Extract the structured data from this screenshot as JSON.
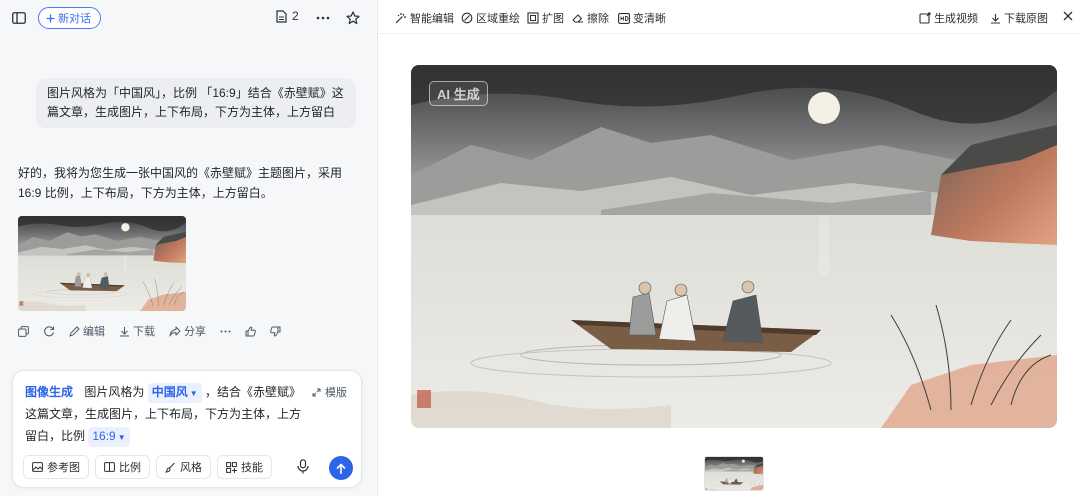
{
  "header_left": {
    "new_chat_label": "新对话",
    "doc_count": "2"
  },
  "conversation": {
    "user_message": "图片风格为「中国风」，比例 「16:9」结合《赤壁赋》这篇文章，生成图片，上下布局，下方为主体，上方留白",
    "assistant_message": "好的，我将为您生成一张中国风的《赤壁赋》主题图片，采用 16:9 比例，上下布局，下方为主体，上方留白。",
    "actions": {
      "edit": "编辑",
      "download": "下载",
      "share": "分享"
    }
  },
  "composer": {
    "mode": "图像生成",
    "text_before": "图片风格为",
    "style_chip": "中国风",
    "text_middle": "，结合《赤壁赋》这篇文章，生成图片，上下布局，下方为主体，上方留白，比例",
    "ratio_chip": "16:9",
    "template_label": "模版",
    "tools": [
      "参考图",
      "比例",
      "风格",
      "技能"
    ]
  },
  "editor_toolbar": {
    "smart_edit": "智能编辑",
    "region_redraw": "区域重绘",
    "expand": "扩图",
    "erase": "擦除",
    "sharpen": "变清晰",
    "generate_video": "生成视频",
    "download_original": "下载原图"
  },
  "image": {
    "watermark": "AI 生成"
  },
  "colors": {
    "accent": "#2d64e8",
    "panel_bg": "#f6f7f9"
  },
  "icons": [
    "sidebar-icon",
    "plus-icon",
    "document-icon",
    "more-icon",
    "star-icon",
    "copy-icon",
    "refresh-icon",
    "edit-icon",
    "download-icon",
    "share-icon",
    "thumb-up-icon",
    "thumb-down-icon",
    "expand-icon",
    "image-icon",
    "ratio-icon",
    "brush-icon",
    "skills-icon",
    "mic-icon",
    "send-icon",
    "wand-icon",
    "region-icon",
    "crop-icon",
    "eraser-icon",
    "hd-icon",
    "video-icon",
    "close-icon"
  ]
}
